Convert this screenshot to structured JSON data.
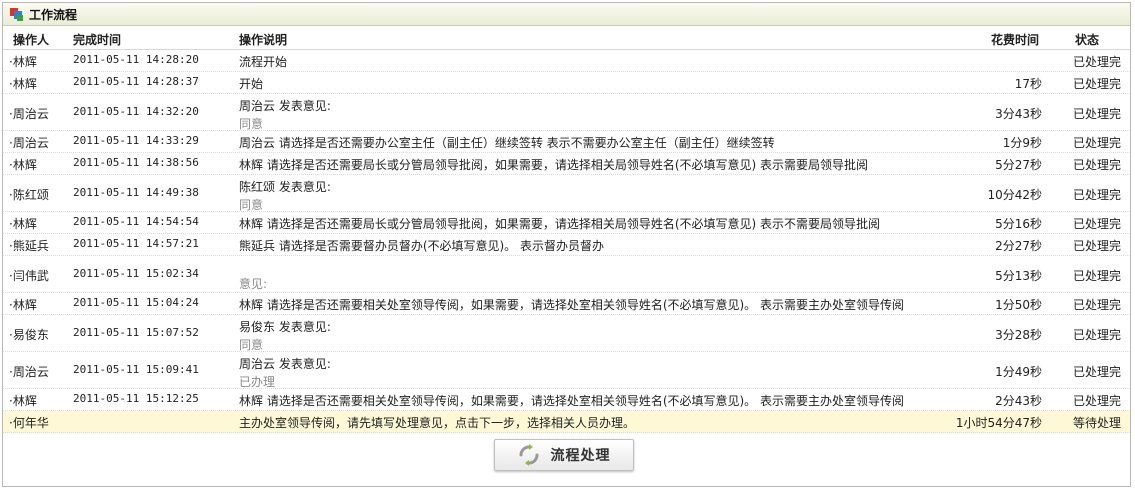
{
  "panel": {
    "title": "工作流程"
  },
  "headers": {
    "operator": "操作人",
    "time": "完成时间",
    "desc": "操作说明",
    "cost": "花费时间",
    "status": "状态"
  },
  "rows": [
    {
      "op": "·林辉",
      "time": "2011-05-11 14:28:20",
      "desc": "流程开始",
      "sub": "",
      "cost": "",
      "status": "已处理完"
    },
    {
      "op": "·林辉",
      "time": "2011-05-11 14:28:37",
      "desc": "开始",
      "sub": "",
      "cost": "17秒",
      "status": "已处理完"
    },
    {
      "op": "·周治云",
      "time": "2011-05-11 14:32:20",
      "desc": "周治云 发表意见:",
      "sub": "同意",
      "cost": "3分43秒",
      "status": "已处理完"
    },
    {
      "op": "·周治云",
      "time": "2011-05-11 14:33:29",
      "desc": "周治云 请选择是否还需要办公室主任（副主任）继续签转 表示不需要办公室主任（副主任）继续签转",
      "sub": "",
      "cost": "1分9秒",
      "status": "已处理完"
    },
    {
      "op": "·林辉",
      "time": "2011-05-11 14:38:56",
      "desc": "林辉 请选择是否还需要局长或分管局领导批阅，如果需要，请选择相关局领导姓名(不必填写意见) 表示需要局领导批阅",
      "sub": "",
      "cost": "5分27秒",
      "status": "已处理完"
    },
    {
      "op": "·陈红颂",
      "time": "2011-05-11 14:49:38",
      "desc": "陈红颂 发表意见:",
      "sub": "同意",
      "cost": "10分42秒",
      "status": "已处理完"
    },
    {
      "op": "·林辉",
      "time": "2011-05-11 14:54:54",
      "desc": "林辉 请选择是否还需要局长或分管局领导批阅，如果需要，请选择相关局领导姓名(不必填写意见) 表示不需要局领导批阅",
      "sub": "",
      "cost": "5分16秒",
      "status": "已处理完"
    },
    {
      "op": "·熊延兵",
      "time": "2011-05-11 14:57:21",
      "desc": "熊延兵 请选择是否需要督办员督办(不必填写意见)。 表示督办员督办",
      "sub": "",
      "cost": "2分27秒",
      "status": "已处理完"
    },
    {
      "op": "·闫伟武",
      "time": "2011-05-11 15:02:34",
      "desc": "",
      "sub": "意见:",
      "cost": "5分13秒",
      "status": "已处理完"
    },
    {
      "op": "·林辉",
      "time": "2011-05-11 15:04:24",
      "desc": "林辉 请选择是否还需要相关处室领导传阅，如果需要，请选择处室相关领导姓名(不必填写意见)。 表示需要主办处室领导传阅",
      "sub": "",
      "cost": "1分50秒",
      "status": "已处理完"
    },
    {
      "op": "·易俊东",
      "time": "2011-05-11 15:07:52",
      "desc": "易俊东 发表意见:",
      "sub": "同意",
      "cost": "3分28秒",
      "status": "已处理完"
    },
    {
      "op": "·周治云",
      "time": "2011-05-11 15:09:41",
      "desc": "周治云 发表意见:",
      "sub": "已办理",
      "cost": "1分49秒",
      "status": "已处理完"
    },
    {
      "op": "·林辉",
      "time": "2011-05-11 15:12:25",
      "desc": "林辉 请选择是否还需要相关处室领导传阅，如果需要，请选择处室相关领导姓名(不必填写意见)。 表示需要主办处室领导传阅",
      "sub": "",
      "cost": "2分43秒",
      "status": "已处理完"
    },
    {
      "op": "·何年华",
      "time": "",
      "desc": "主办处室领导传阅，请先填写处理意见，点击下一步，选择相关人员办理。",
      "sub": "",
      "cost": "1小时54分47秒",
      "status": "等待处理",
      "highlight": true
    }
  ],
  "button": {
    "label": "流程处理"
  }
}
